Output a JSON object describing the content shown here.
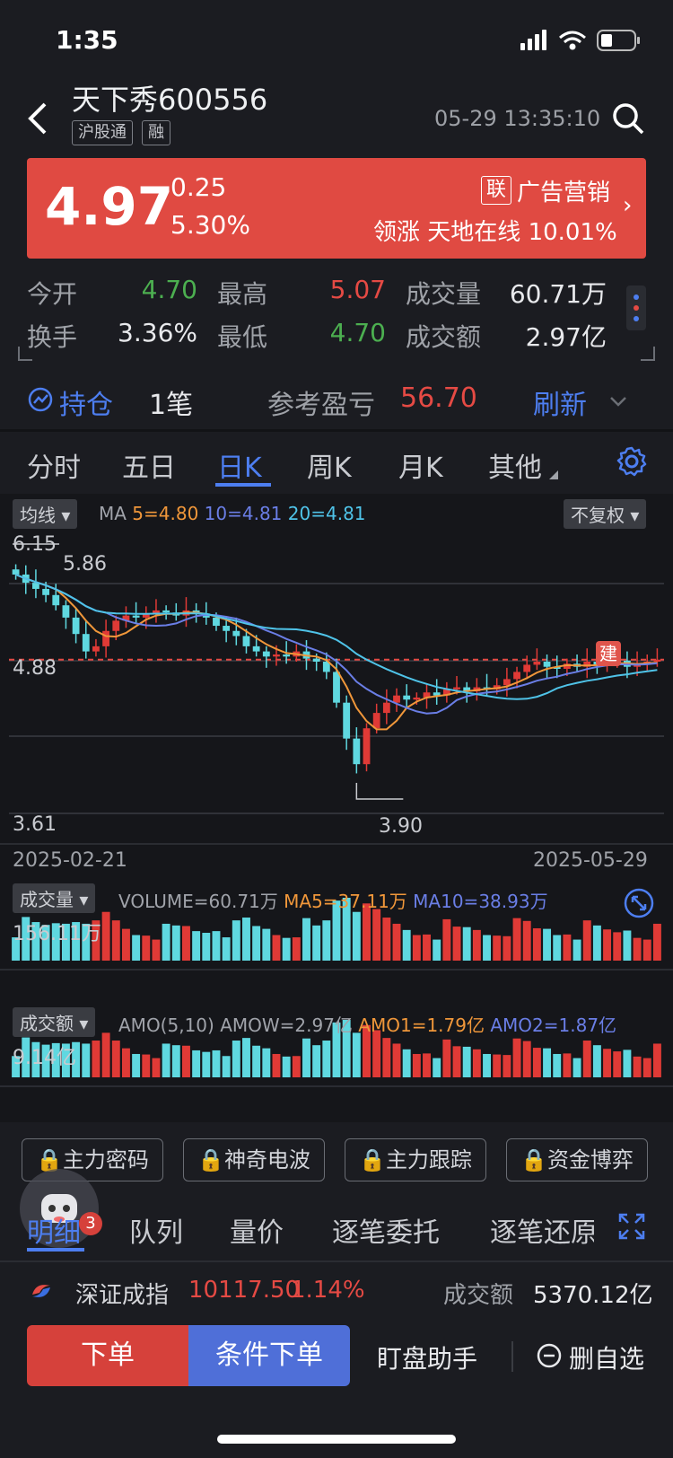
{
  "status": {
    "time": "1:35"
  },
  "header": {
    "stock_name": "天下秀",
    "stock_code": "600556",
    "tags": [
      "沪股通",
      "融"
    ],
    "datetime": "05-29 13:35:10"
  },
  "price_card": {
    "price": "4.97",
    "change": "0.25",
    "change_pct": "5.30%",
    "concept_badge": "联",
    "concept": "广告营销",
    "leader_label": "领涨",
    "leader_name": "天地在线",
    "leader_pct": "10.01%"
  },
  "quote": {
    "open_label": "今开",
    "open": "4.70",
    "high_label": "最高",
    "high": "5.07",
    "vol_label": "成交量",
    "vol": "60.71万",
    "turnover_label": "换手",
    "turnover": "3.36%",
    "low_label": "最低",
    "low": "4.70",
    "amount_label": "成交额",
    "amount": "2.97亿"
  },
  "holdings": {
    "label": "持仓",
    "count": "1笔",
    "pnl_label": "参考盈亏",
    "pnl": "56.70",
    "refresh": "刷新"
  },
  "period_tabs": [
    "分时",
    "五日",
    "日K",
    "周K",
    "月K",
    "其他"
  ],
  "chart": {
    "ma_btn": "均线",
    "ma_label": "MA",
    "ma5": "5=4.80",
    "ma10": "10=4.81",
    "ma20": "20=4.81",
    "adjust_btn": "不复权",
    "build_badge": "建",
    "date_start": "2025-02-21",
    "date_end": "2025-05-29",
    "vol_btn": "成交量",
    "vol_legend": "VOLUME=60.71万",
    "vol_ma5": "MA5=37.11万",
    "vol_ma10": "MA10=38.93万",
    "vol_max": "156.11万",
    "amo_btn": "成交额",
    "amo_legend": "AMO(5,10)",
    "amow": "AMOW=2.97亿",
    "amo1": "AMO1=1.79亿",
    "amo2": "AMO2=1.87亿",
    "amo_max": "9.14亿"
  },
  "chart_data": {
    "type": "candlestick",
    "y_ticks": [
      "6.15",
      "4.88",
      "3.61"
    ],
    "ylim": [
      3.61,
      6.15
    ],
    "max_label": "5.86",
    "min_label": "3.90",
    "last_close": 4.97,
    "closes": [
      5.8,
      5.72,
      5.66,
      5.6,
      5.5,
      5.38,
      5.22,
      5.05,
      5.1,
      5.25,
      5.35,
      5.4,
      5.38,
      5.42,
      5.45,
      5.43,
      5.4,
      5.45,
      5.42,
      5.38,
      5.3,
      5.25,
      5.2,
      5.1,
      5.05,
      5.0,
      5.02,
      5.0,
      5.05,
      4.98,
      4.95,
      4.85,
      4.55,
      4.2,
      3.95,
      4.3,
      4.45,
      4.55,
      4.62,
      4.58,
      4.6,
      4.65,
      4.62,
      4.68,
      4.7,
      4.66,
      4.7,
      4.68,
      4.72,
      4.78,
      4.85,
      4.92,
      4.95,
      4.9,
      4.88,
      4.93,
      4.9,
      4.95,
      4.92,
      4.94,
      4.96,
      4.9,
      4.92,
      4.95,
      4.97
    ],
    "vol_max": 156.11,
    "amo_max": 9.14
  },
  "tools": [
    "主力密码",
    "神奇电波",
    "主力跟踪",
    "资金博弈"
  ],
  "sub_tabs": [
    "明细",
    "队列",
    "量价",
    "逐笔委托",
    "逐笔还原"
  ],
  "detail_badge": "3",
  "index_bar": {
    "name": "深证成指",
    "value": "10117.50",
    "pct": "1.14%",
    "amount_label": "成交额",
    "amount": "5370.12亿"
  },
  "actions": {
    "order": "下单",
    "cond_order": "条件下单",
    "assistant": "盯盘助手",
    "del_watch": "删自选"
  }
}
